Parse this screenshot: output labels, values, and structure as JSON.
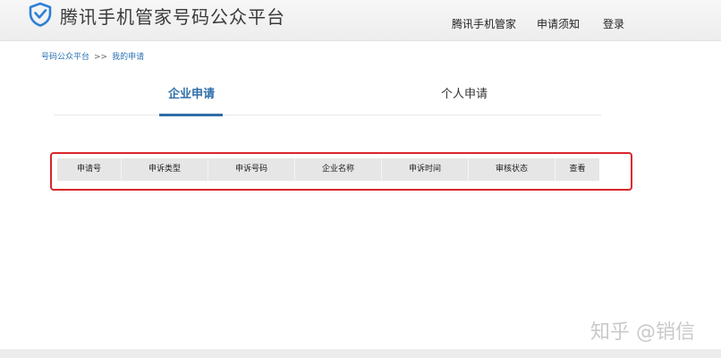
{
  "header": {
    "brand": "腾讯手机管家号码公众平台",
    "nav": [
      {
        "label": "腾讯手机管家"
      },
      {
        "label": "申请须知"
      },
      {
        "label": "登录"
      }
    ]
  },
  "breadcrumb": {
    "home": "号码公众平台",
    "separator": ">>",
    "current": "我的申请"
  },
  "tabs": [
    {
      "label": "企业申请",
      "active": true
    },
    {
      "label": "个人申请",
      "active": false
    }
  ],
  "table": {
    "columns": [
      "申请号",
      "申诉类型",
      "申诉号码",
      "企业名称",
      "申诉时间",
      "审核状态",
      "查看"
    ]
  },
  "watermark": "知乎 @销信",
  "colors": {
    "accent": "#2e6ea8",
    "logo": "#2f7fd6",
    "highlight": "#d9262b"
  }
}
